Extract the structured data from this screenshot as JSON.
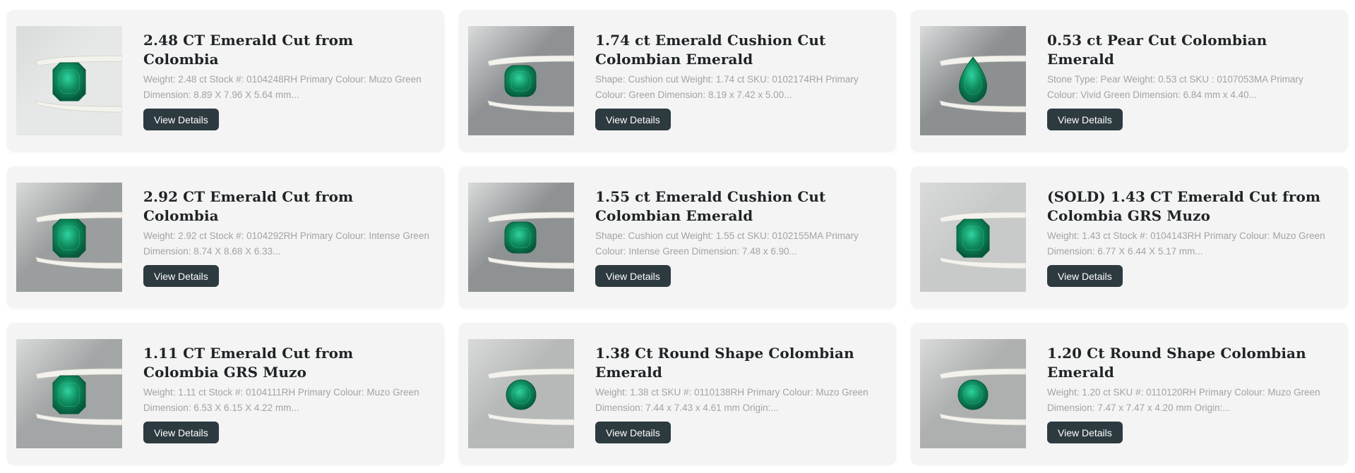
{
  "products": [
    {
      "title": "2.48 CT Emerald Cut from Colombia",
      "description": "Weight: 2.48 ct Stock #: 0104248RH Primary Colour:  Muzo Green Dimension: 8.89 X 7.96 X 5.64 mm...",
      "button_label": "View Details",
      "image_icon": "emerald-octagon-icon",
      "background": "#e6e8e8"
    },
    {
      "title": "1.74 ct Emerald Cushion Cut Colombian Emerald",
      "description": "Shape: Cushion cut Weight: 1.74 ct SKU: 0102174RH Primary Colour: Green Dimension: 8.19 x 7.42 x 5.00...",
      "button_label": "View Details",
      "image_icon": "emerald-cushion-icon",
      "background": "#8e9294"
    },
    {
      "title": "0.53 ct Pear Cut Colombian Emerald",
      "description": "Stone Type: Pear Weight: 0.53 ct SKU : 0107053MA Primary Colour: Vivid Green Dimension: 6.84 mm x 4.40...",
      "button_label": "View Details",
      "image_icon": "emerald-pear-icon",
      "background": "#8c9091"
    },
    {
      "title": "2.92 CT Emerald Cut from Colombia",
      "description": "Weight: 2.92 ct Stock #: 0104292RH Primary Colour:  Intense Green Dimension: 8.74 X 8.68 X 6.33...",
      "button_label": "View Details",
      "image_icon": "emerald-octagon-icon",
      "background": "#9b9e9e"
    },
    {
      "title": "1.55 ct Emerald Cushion Cut Colombian Emerald",
      "description": "Shape: Cushion cut Weight: 1.55 ct SKU: 0102155MA Primary Colour: Intense Green Dimension: 7.48 x 6.90...",
      "button_label": "View Details",
      "image_icon": "emerald-cushion-icon",
      "background": "#8f9293"
    },
    {
      "title": "(SOLD) 1.43 CT Emerald Cut from Colombia GRS Muzo",
      "description": "Weight: 1.43 ct Stock #: 0104143RH Primary Colour:  Muzo Green Dimension: 6.77 X 6.44 X 5.17 mm...",
      "button_label": "View Details",
      "image_icon": "emerald-octagon-icon",
      "background": "#c8caca"
    },
    {
      "title": "1.11 CT Emerald Cut from Colombia GRS Muzo",
      "description": "Weight: 1.11 ct Stock #: 0104111RH Primary Colour:  Muzo Green Dimension: 6.53 X 6.15 X 4.22 mm...",
      "button_label": "View Details",
      "image_icon": "emerald-octagon-icon",
      "background": "#a3a6a6"
    },
    {
      "title": "1.38 Ct Round Shape Colombian Emerald",
      "description": "Weight: 1.38 ct SKU #: 0110138RH Primary Colour: Muzo Green Dimension: 7.44 x 7.43 x 4.61 mm Origin:...",
      "button_label": "View Details",
      "image_icon": "emerald-round-icon",
      "background": "#b7b9b9"
    },
    {
      "title": "1.20 Ct Round Shape Colombian Emerald",
      "description": "Weight: 1.20 ct SKU #: 0110120RH Primary Colour: Muzo Green Dimension: 7.47 x 7.47 x 4.20 mm Origin:...",
      "button_label": "View Details",
      "image_icon": "emerald-round-icon",
      "background": "#aeb0b0"
    }
  ],
  "colors": {
    "card_background": "#f4f4f4",
    "button_background": "#2d3a40",
    "title_text": "#1f2426",
    "description_text": "#a3a3a3",
    "emerald": "#0f8a5c",
    "emerald_light": "#2fd3a0",
    "emerald_dark": "#065a3c",
    "tweezer": "#f4f2ec"
  }
}
